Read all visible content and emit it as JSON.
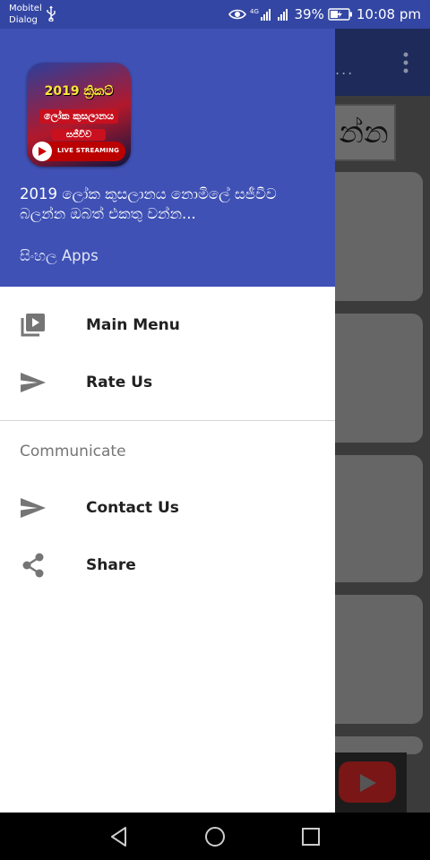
{
  "status_bar": {
    "carrier_line1": "Mobitel",
    "carrier_line2": "Dialog",
    "network_type": "4G",
    "battery_percent": "39%",
    "time": "10:08 pm"
  },
  "background_app": {
    "header_fragment": "න්න",
    "toolbar_fragment": "..."
  },
  "drawer": {
    "logo": {
      "line1": "2019 ක්‍රිකට්",
      "line2": "ලෝක කුසලානය",
      "line3": "සජීවිව",
      "badge": "LIVE STREAMING"
    },
    "app_name": "2019 ලෝක කුසලානය නොමිලේ සජීවීව බලන්න ඔබත් එකතු වන්න...",
    "developer": "සිංහල Apps",
    "items": [
      {
        "label": "Main Menu",
        "icon": "video-library-icon"
      },
      {
        "label": "Rate Us",
        "icon": "send-icon"
      }
    ],
    "section_title": "Communicate",
    "communicate_items": [
      {
        "label": "Contact Us",
        "icon": "send-icon"
      },
      {
        "label": "Share",
        "icon": "share-icon"
      }
    ]
  },
  "colors": {
    "status_bar": "#3346a3",
    "drawer_header": "#3f51b5",
    "icon_gray": "#757575"
  }
}
